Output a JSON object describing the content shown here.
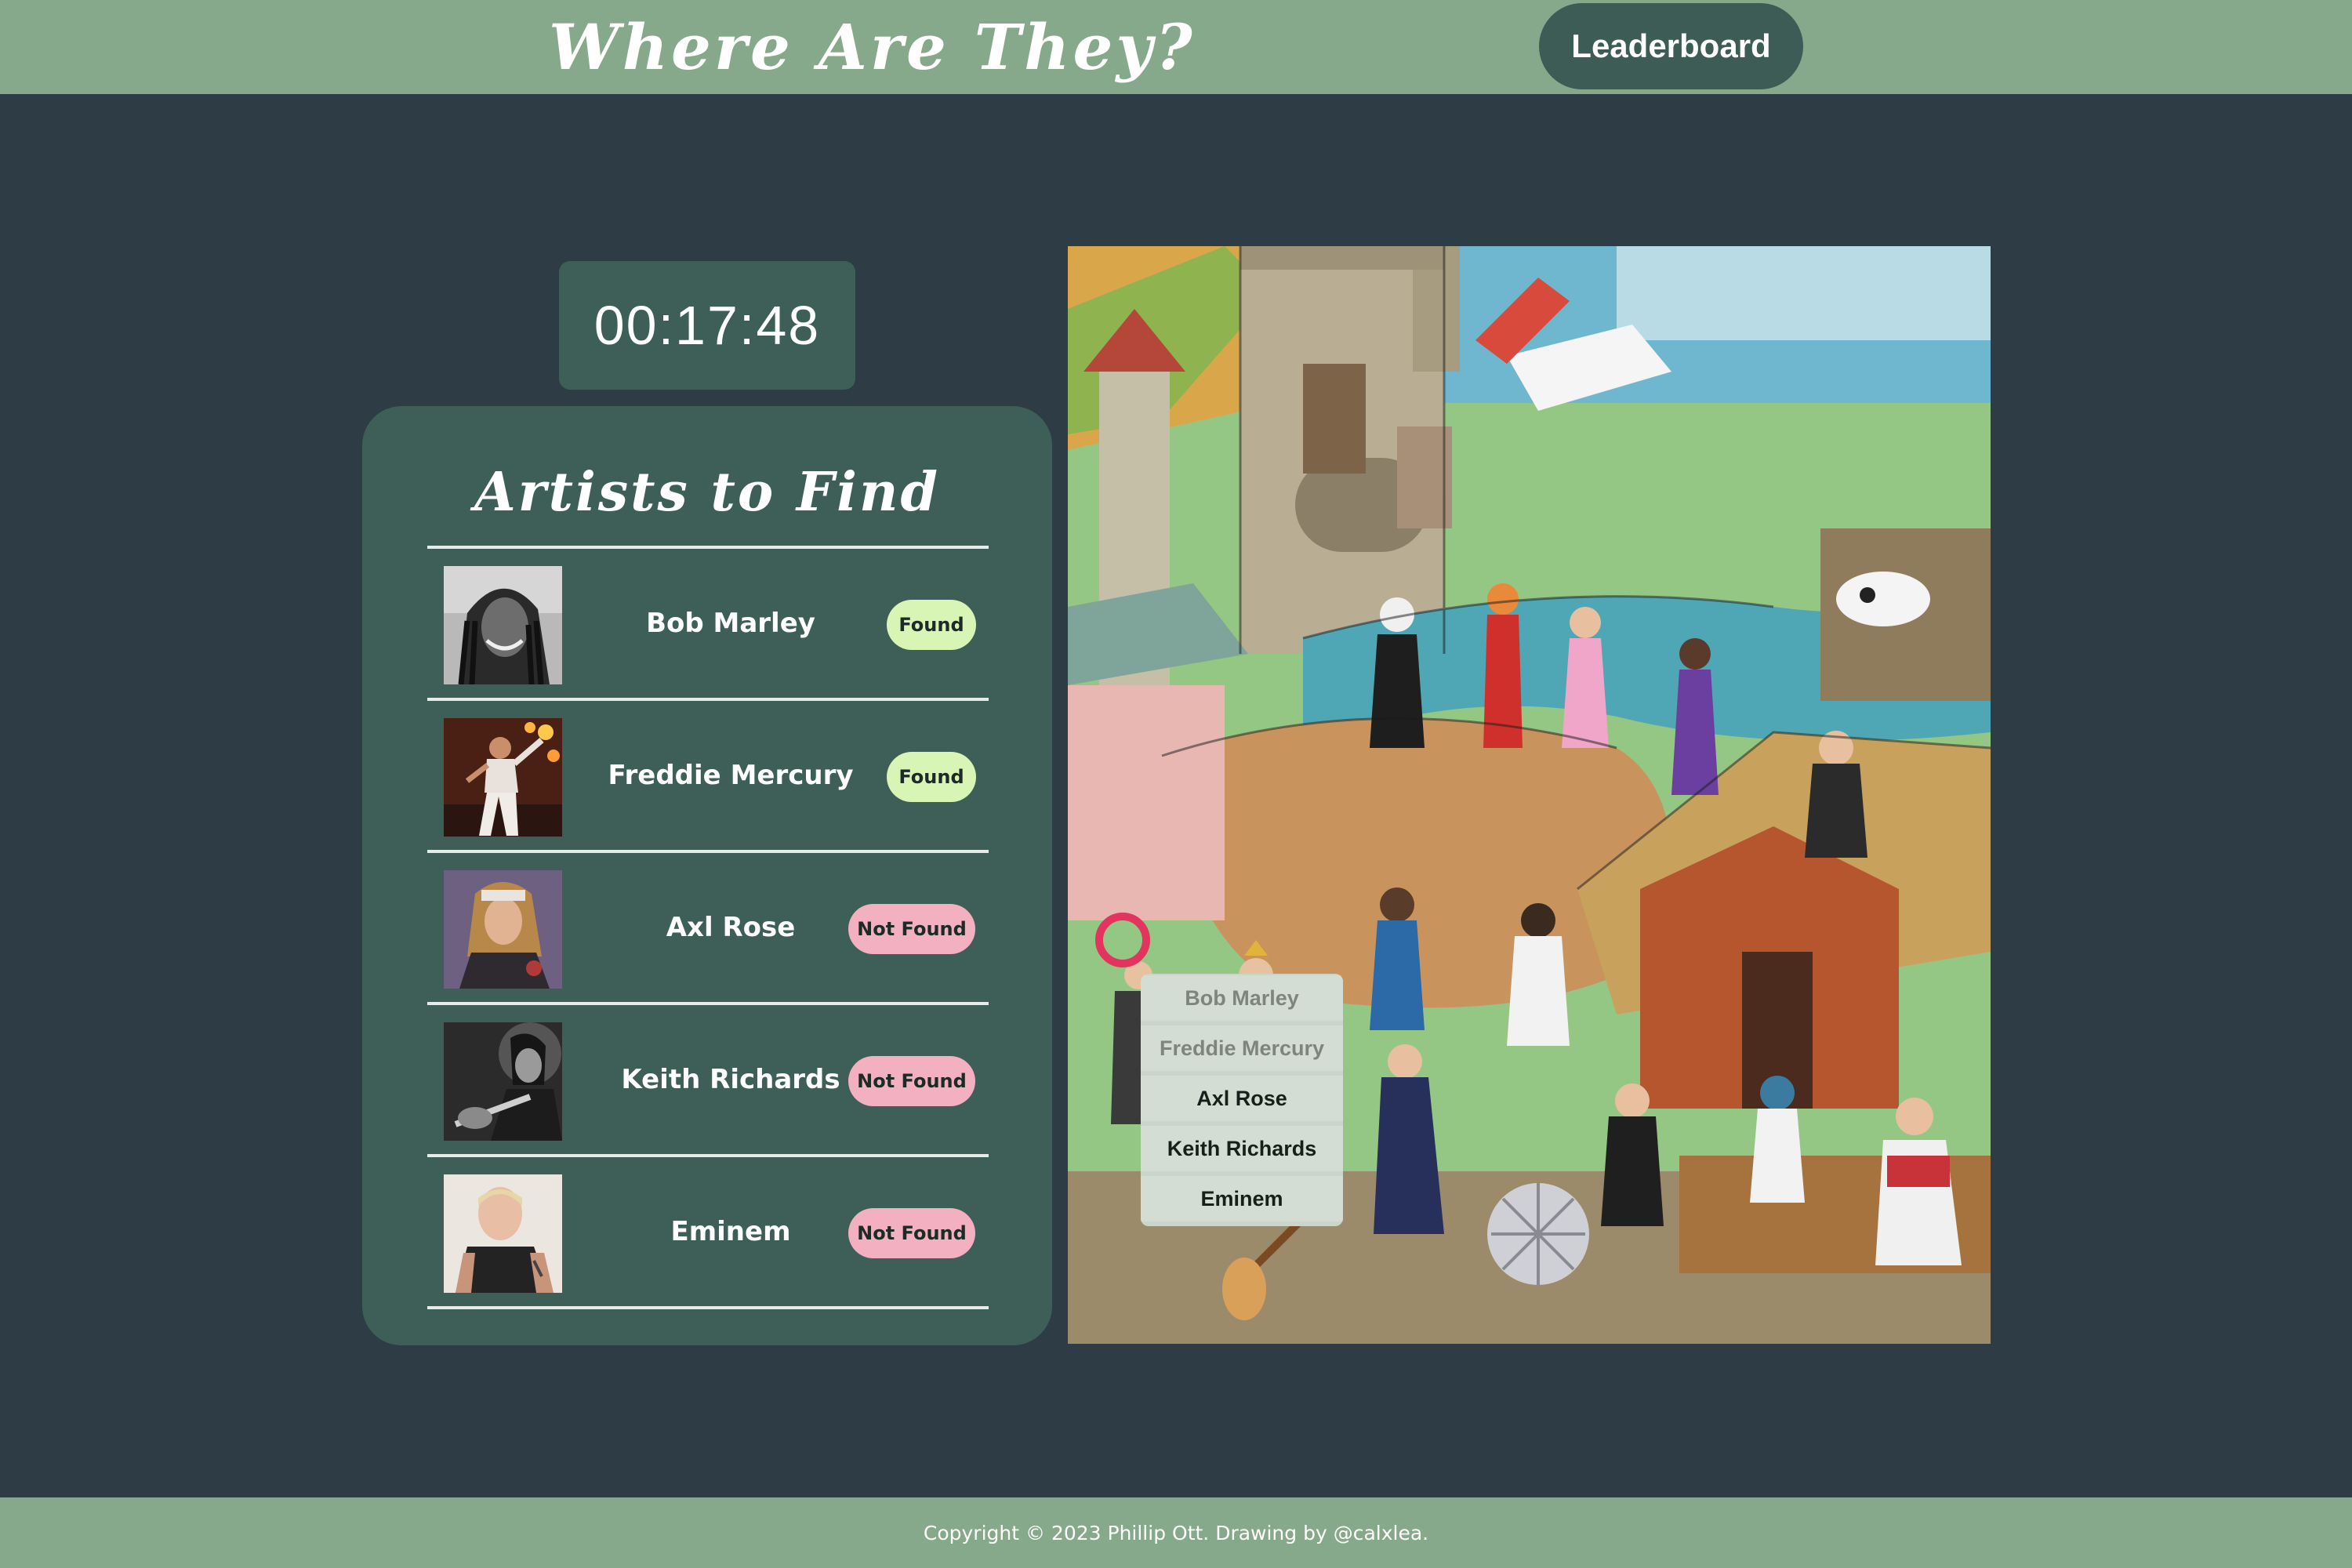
{
  "header": {
    "title": "Where Are They?",
    "leaderboard_label": "Leaderboard"
  },
  "timer": {
    "value": "00:17:48"
  },
  "panel": {
    "title": "Artists to Find",
    "artists": [
      {
        "name": "Bob Marley",
        "status": "Found"
      },
      {
        "name": "Freddie Mercury",
        "status": "Found"
      },
      {
        "name": "Axl Rose",
        "status": "Not Found"
      },
      {
        "name": "Keith Richards",
        "status": "Not Found"
      },
      {
        "name": "Eminem",
        "status": "Not Found"
      }
    ]
  },
  "dropdown": {
    "options": [
      "Bob Marley",
      "Freddie Mercury",
      "Axl Rose",
      "Keith Richards",
      "Eminem"
    ]
  },
  "footer": {
    "text": "Copyright © 2023 Phillip Ott. Drawing by @calxlea."
  },
  "colors": {
    "header_bg": "#87a98b",
    "page_bg": "#2e3c45",
    "panel_bg": "#3d5f57",
    "found_badge": "#d8f5b5",
    "not_found_badge": "#f2b0c1",
    "marker": "#e2345e"
  }
}
